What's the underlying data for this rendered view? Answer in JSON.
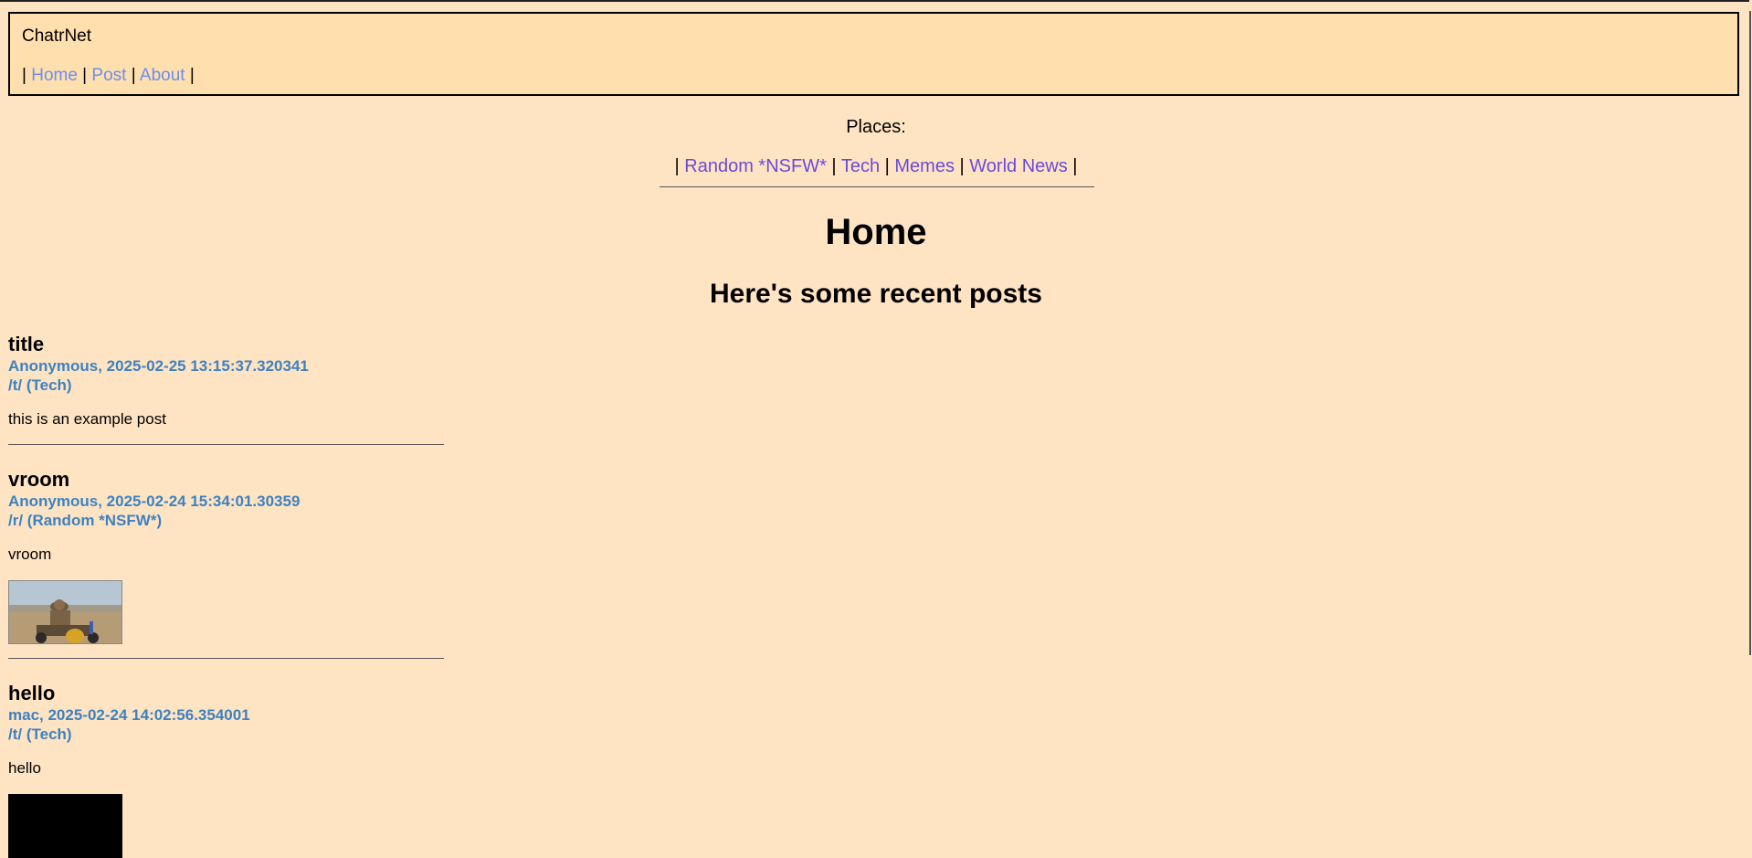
{
  "header": {
    "brand": "ChatrNet",
    "nav": [
      {
        "label": "Home"
      },
      {
        "label": "Post"
      },
      {
        "label": "About"
      }
    ]
  },
  "places": {
    "label": "Places:",
    "items": [
      {
        "label": "Random *NSFW*"
      },
      {
        "label": "Tech"
      },
      {
        "label": "Memes"
      },
      {
        "label": "World News"
      }
    ]
  },
  "main": {
    "title": "Home",
    "subtitle": "Here's some recent posts"
  },
  "posts": [
    {
      "title": "title",
      "author_time": "Anonymous, 2025-02-25 13:15:37.320341",
      "board": "/t/ (Tech)",
      "body": "this is an example post"
    },
    {
      "title": "vroom",
      "author_time": "Anonymous, 2025-02-24 15:34:01.30359",
      "board": "/r/ (Random *NSFW*)",
      "body": "vroom"
    },
    {
      "title": "hello",
      "author_time": "mac, 2025-02-24 14:02:56.354001",
      "board": "/t/ (Tech)",
      "body": "hello"
    }
  ],
  "colors": {
    "page_bg": "#ffe4c4",
    "header_bg": "#ffdfad",
    "nav_link": "#6b8ff0",
    "place_link": "#6a4ad8",
    "meta": "#3d82c0"
  }
}
